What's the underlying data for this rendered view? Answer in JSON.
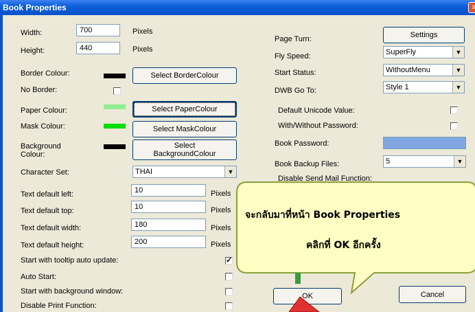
{
  "window": {
    "title": "Book Properties",
    "close_glyph": "x"
  },
  "left": {
    "width_label": "Width:",
    "width_value": "700",
    "width_unit": "Pixels",
    "height_label": "Height:",
    "height_value": "440",
    "height_unit": "Pixels",
    "border_colour_label": "Border Colour:",
    "border_colour_button": "Select BorderColour",
    "no_border_label": "No Border:",
    "paper_colour_label": "Paper Colour:",
    "paper_colour_button": "Select PaperColour",
    "mask_colour_label": "Mask Colour:",
    "mask_colour_button": "Select MaskColour",
    "background_colour_label_1": "Background",
    "background_colour_label_2": "Colour:",
    "background_colour_button_1": "Select",
    "background_colour_button_2": "BackgroundColour",
    "character_set_label": "Character Set:",
    "character_set_value": "THAI",
    "text_left_label": "Text default left:",
    "text_left_value": "10",
    "text_left_unit": "Pixels",
    "text_top_label": "Text default top:",
    "text_top_value": "10",
    "text_top_unit": "Pixels",
    "text_width_label": "Text default width:",
    "text_width_value": "180",
    "text_width_unit": "Pixels",
    "text_height_label": "Text default height:",
    "text_height_value": "200",
    "text_height_unit": "Pixels",
    "tooltip_label": "Start with tooltip auto update:",
    "tooltip_check": "✓",
    "auto_start_label": "Auto Start:",
    "bg_window_label": "Start with background window:",
    "disable_print_label": "Disable Print Function:"
  },
  "right": {
    "page_turn_label": "Page Turn:",
    "settings_button": "Settings",
    "fly_speed_label": "Fly Speed:",
    "fly_speed_value": "SuperFly",
    "start_status_label": "Start Status:",
    "start_status_value": "WithoutMenu",
    "dwb_goto_label": "DWB Go To:",
    "dwb_goto_value": "Style 1",
    "unicode_label": "Default Unicode Value:",
    "password_toggle_label": "With/Without Password:",
    "book_password_label": "Book Password:",
    "backup_label": "Book Backup Files:",
    "backup_value": "5",
    "disable_mail_label": "Disable Send Mail Function:"
  },
  "buttons": {
    "ok": "OK",
    "cancel": "Cancel"
  },
  "callout": {
    "line1": "จะกลับมาที่หน้า Book Properties",
    "line2": "คลิกที่ OK อีกครั้ง"
  },
  "colors": {
    "border_swatch": "#000000",
    "paper_swatch": "#90ee90",
    "mask_swatch": "#00dd00",
    "background_swatch": "#000000",
    "password_field": "#7fa6e0",
    "callout_fill": "#ffffc4",
    "callout_border": "#8aa039",
    "pointer": "#e03030"
  }
}
